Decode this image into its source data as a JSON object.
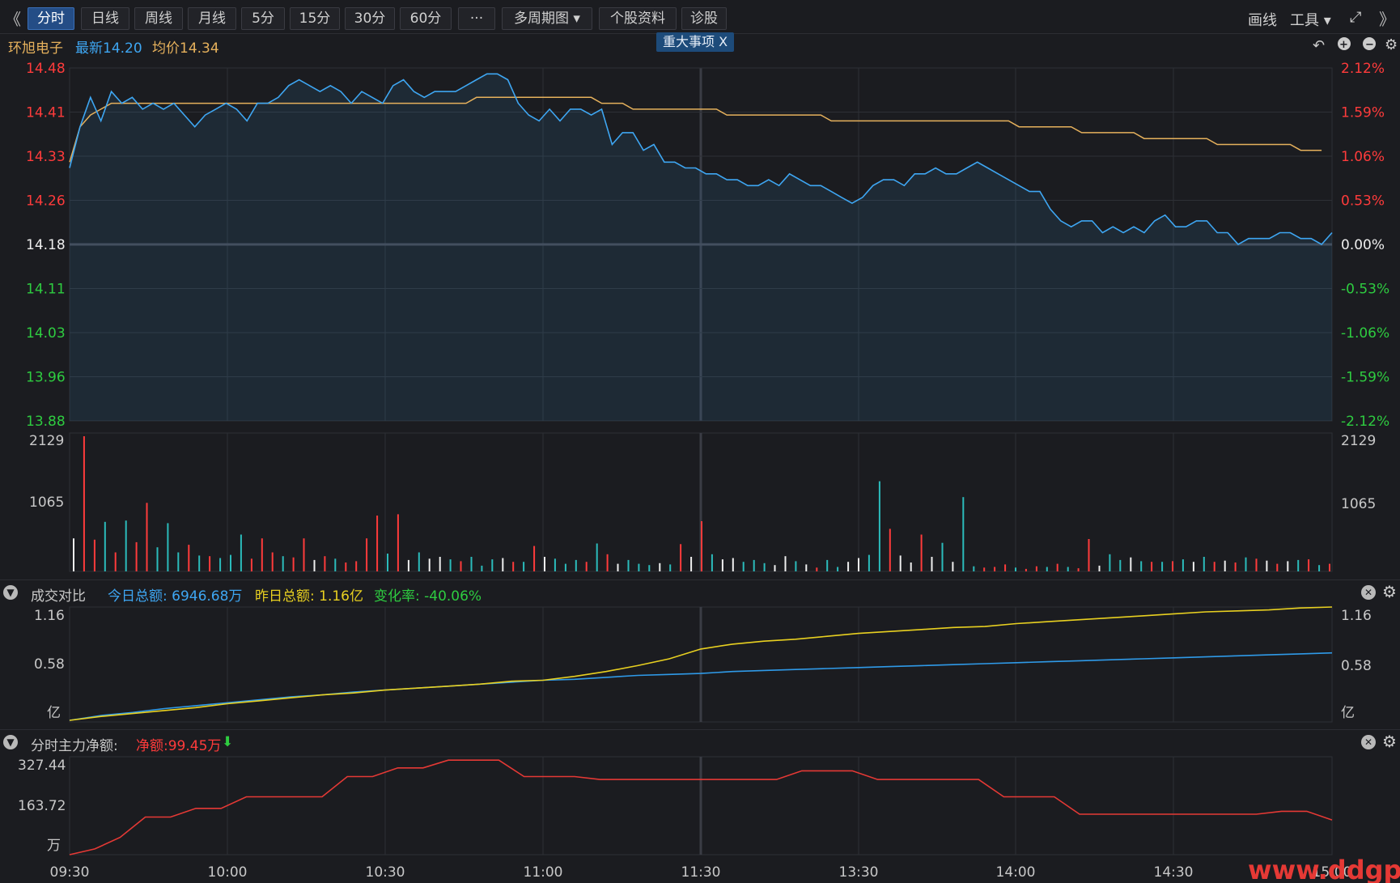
{
  "toolbar": {
    "left_arrow": "《",
    "right_arrow": "》",
    "buttons": [
      {
        "label": "分时",
        "active": true
      },
      {
        "label": "日线"
      },
      {
        "label": "周线"
      },
      {
        "label": "月线"
      },
      {
        "label": "5分"
      },
      {
        "label": "15分"
      },
      {
        "label": "30分"
      },
      {
        "label": "60分"
      },
      {
        "label": "···"
      },
      {
        "label": "多周期图 ▾"
      },
      {
        "label": "个股资料"
      },
      {
        "label": "诊股"
      }
    ],
    "draw_label": "画线",
    "tools_label": "工具 ▾",
    "expand_icon": "⤢"
  },
  "info": {
    "stock_name": "环旭电子",
    "latest": "最新14.20",
    "avg_price": "均价14.34",
    "event_tag": "重大事项  X"
  },
  "colors": {
    "up": "#ff3b3b",
    "down": "#2ecc40",
    "price_line": "#3ea6f2",
    "avg_line": "#e6b15c",
    "today_line": "#2f9ae8",
    "yesterday_line": "#e8d020",
    "net_line": "#e53935",
    "grid": "#2e3036",
    "white": "#eeeeee",
    "cyan": "#2bbbbb"
  },
  "panel2": {
    "title": "成交对比",
    "today": "今日总额: 6946.68万",
    "yesterday": "昨日总额: 1.16亿",
    "change": "变化率: -40.06%"
  },
  "panel3": {
    "title": "分时主力净额:",
    "net": "净额:99.45万",
    "arrow": "⬇"
  },
  "watermark": "www.ddgp.net",
  "chart_data": [
    {
      "type": "line",
      "title": "分时",
      "series": [
        {
          "name": "最新",
          "values": [
            14.31,
            14.38,
            14.43,
            14.39,
            14.44,
            14.42,
            14.43,
            14.41,
            14.42,
            14.41,
            14.42,
            14.4,
            14.38,
            14.4,
            14.41,
            14.42,
            14.41,
            14.39,
            14.42,
            14.42,
            14.43,
            14.45,
            14.46,
            14.45,
            14.44,
            14.45,
            14.44,
            14.42,
            14.44,
            14.43,
            14.42,
            14.45,
            14.46,
            14.44,
            14.43,
            14.44,
            14.44,
            14.44,
            14.45,
            14.46,
            14.47,
            14.47,
            14.46,
            14.42,
            14.4,
            14.39,
            14.41,
            14.39,
            14.41,
            14.41,
            14.4,
            14.41,
            14.35,
            14.37,
            14.37,
            14.34,
            14.35,
            14.32,
            14.32,
            14.31,
            14.31,
            14.3,
            14.3,
            14.29,
            14.29,
            14.28,
            14.28,
            14.29,
            14.28,
            14.3,
            14.29,
            14.28,
            14.28,
            14.27,
            14.26,
            14.25,
            14.26,
            14.28,
            14.29,
            14.29,
            14.28,
            14.3,
            14.3,
            14.31,
            14.3,
            14.3,
            14.31,
            14.32,
            14.31,
            14.3,
            14.29,
            14.28,
            14.27,
            14.27,
            14.24,
            14.22,
            14.21,
            14.22,
            14.22,
            14.2,
            14.21,
            14.2,
            14.21,
            14.2,
            14.22,
            14.23,
            14.21,
            14.21,
            14.22,
            14.22,
            14.2,
            14.2,
            14.18,
            14.19,
            14.19,
            14.19,
            14.2,
            14.2,
            14.19,
            14.19,
            14.18,
            14.2
          ]
        },
        {
          "name": "均价",
          "values": [
            14.32,
            14.38,
            14.4,
            14.41,
            14.42,
            14.42,
            14.42,
            14.42,
            14.42,
            14.42,
            14.42,
            14.42,
            14.42,
            14.42,
            14.42,
            14.42,
            14.42,
            14.42,
            14.42,
            14.42,
            14.42,
            14.42,
            14.42,
            14.42,
            14.42,
            14.42,
            14.42,
            14.42,
            14.42,
            14.42,
            14.42,
            14.42,
            14.42,
            14.42,
            14.42,
            14.42,
            14.42,
            14.42,
            14.42,
            14.43,
            14.43,
            14.43,
            14.43,
            14.43,
            14.43,
            14.43,
            14.43,
            14.43,
            14.43,
            14.43,
            14.43,
            14.42,
            14.42,
            14.42,
            14.41,
            14.41,
            14.41,
            14.41,
            14.41,
            14.41,
            14.41,
            14.41,
            14.41,
            14.4,
            14.4,
            14.4,
            14.4,
            14.4,
            14.4,
            14.4,
            14.4,
            14.4,
            14.4,
            14.39,
            14.39,
            14.39,
            14.39,
            14.39,
            14.39,
            14.39,
            14.39,
            14.39,
            14.39,
            14.39,
            14.39,
            14.39,
            14.39,
            14.39,
            14.39,
            14.39,
            14.39,
            14.38,
            14.38,
            14.38,
            14.38,
            14.38,
            14.38,
            14.37,
            14.37,
            14.37,
            14.37,
            14.37,
            14.37,
            14.36,
            14.36,
            14.36,
            14.36,
            14.36,
            14.36,
            14.36,
            14.35,
            14.35,
            14.35,
            14.35,
            14.35,
            14.35,
            14.35,
            14.35,
            14.34,
            14.34,
            14.34
          ]
        }
      ],
      "y_ticks_left": [
        "14.48",
        "14.41",
        "14.33",
        "14.26",
        "14.18",
        "14.11",
        "14.03",
        "13.96",
        "13.88"
      ],
      "y_ticks_right": [
        "2.12%",
        "1.59%",
        "1.06%",
        "0.53%",
        "0.00%",
        "-0.53%",
        "-1.06%",
        "-1.59%",
        "-2.12%"
      ],
      "ylim": [
        13.88,
        14.48
      ],
      "x_ticks": [
        "09:30",
        "10:00",
        "10:30",
        "11:00",
        "11:30",
        "13:30",
        "14:00",
        "14:30",
        "15:00"
      ]
    },
    {
      "type": "bar",
      "title": "成交量",
      "y_ticks": [
        "2129",
        "1065"
      ],
      "ylim": [
        0,
        2129
      ],
      "values": [
        520,
        2129,
        500,
        780,
        300,
        800,
        460,
        1080,
        380,
        760,
        300,
        420,
        250,
        240,
        210,
        260,
        580,
        200,
        520,
        300,
        240,
        220,
        520,
        180,
        240,
        200,
        140,
        160,
        520,
        880,
        280,
        900,
        180,
        300,
        200,
        230,
        190,
        160,
        230,
        90,
        190,
        210,
        150,
        150,
        400,
        230,
        200,
        120,
        180,
        150,
        440,
        270,
        120,
        180,
        120,
        100,
        130,
        110,
        430,
        230,
        790,
        270,
        190,
        210,
        150,
        180,
        130,
        100,
        240,
        160,
        110,
        60,
        180,
        70,
        150,
        210,
        260,
        1420,
        670,
        250,
        140,
        580,
        230,
        450,
        150,
        1170,
        80,
        60,
        70,
        110,
        60,
        40,
        80,
        70,
        120,
        70,
        50,
        510,
        90,
        270,
        180,
        220,
        160,
        150,
        150,
        160,
        190,
        150,
        230,
        150,
        170,
        140,
        220,
        200,
        170,
        120,
        160,
        180,
        190,
        100,
        120
      ],
      "colors": [
        "w",
        "u",
        "u",
        "c",
        "u",
        "c",
        "u",
        "u",
        "c",
        "c",
        "c",
        "u",
        "c",
        "u",
        "c",
        "c",
        "c",
        "u",
        "u",
        "u",
        "c",
        "u",
        "u",
        "w",
        "u",
        "c",
        "u",
        "u",
        "u",
        "u",
        "c",
        "u",
        "w",
        "c",
        "w",
        "w",
        "c",
        "u",
        "c",
        "c",
        "c",
        "w",
        "u",
        "c",
        "u",
        "w",
        "c",
        "c",
        "c",
        "u",
        "c",
        "u",
        "w",
        "c",
        "c",
        "c",
        "w",
        "c",
        "u",
        "w",
        "u",
        "c",
        "w",
        "w",
        "c",
        "c",
        "c",
        "w",
        "w",
        "c",
        "w",
        "u",
        "c",
        "c",
        "w",
        "w",
        "c",
        "c",
        "u",
        "w",
        "w",
        "u",
        "w",
        "c",
        "w",
        "c",
        "c",
        "u",
        "u",
        "u",
        "c",
        "u",
        "u",
        "c",
        "u",
        "c",
        "u",
        "u",
        "w",
        "c",
        "c",
        "w",
        "c",
        "u",
        "c",
        "u",
        "c",
        "w",
        "c",
        "u",
        "w",
        "u",
        "c",
        "u",
        "w",
        "u",
        "w",
        "c",
        "u",
        "c",
        "u"
      ]
    },
    {
      "type": "line",
      "title": "成交对比",
      "y_ticks": [
        "1.16",
        "0.58",
        "亿"
      ],
      "ylim": [
        0,
        1.16
      ],
      "series": [
        {
          "name": "今日总额",
          "values": [
            0.0,
            0.05,
            0.08,
            0.12,
            0.15,
            0.18,
            0.21,
            0.24,
            0.26,
            0.29,
            0.31,
            0.33,
            0.35,
            0.37,
            0.39,
            0.41,
            0.42,
            0.44,
            0.46,
            0.47,
            0.48,
            0.5,
            0.51,
            0.52,
            0.53,
            0.54,
            0.55,
            0.56,
            0.57,
            0.58,
            0.59,
            0.6,
            0.61,
            0.62,
            0.63,
            0.64,
            0.65,
            0.66,
            0.67,
            0.68,
            0.69
          ]
        },
        {
          "name": "昨日总额",
          "values": [
            0.0,
            0.04,
            0.07,
            0.1,
            0.13,
            0.17,
            0.2,
            0.23,
            0.26,
            0.28,
            0.31,
            0.33,
            0.35,
            0.37,
            0.4,
            0.41,
            0.45,
            0.5,
            0.56,
            0.63,
            0.73,
            0.78,
            0.81,
            0.83,
            0.86,
            0.89,
            0.91,
            0.93,
            0.95,
            0.96,
            0.99,
            1.01,
            1.03,
            1.05,
            1.07,
            1.09,
            1.11,
            1.12,
            1.13,
            1.15,
            1.16
          ]
        }
      ]
    },
    {
      "type": "line",
      "title": "分时主力净额",
      "y_ticks": [
        "327.44",
        "163.72",
        "万"
      ],
      "ylim": [
        0,
        327.44
      ],
      "series": [
        {
          "name": "净额",
          "values": [
            0,
            20,
            60,
            130,
            130,
            160,
            160,
            200,
            200,
            200,
            200,
            270,
            270,
            300,
            300,
            327,
            327,
            327,
            270,
            270,
            270,
            260,
            260,
            260,
            260,
            260,
            260,
            260,
            260,
            290,
            290,
            290,
            260,
            260,
            260,
            260,
            260,
            200,
            200,
            200,
            140,
            140,
            140,
            140,
            140,
            140,
            140,
            140,
            150,
            150,
            120
          ]
        }
      ]
    }
  ]
}
